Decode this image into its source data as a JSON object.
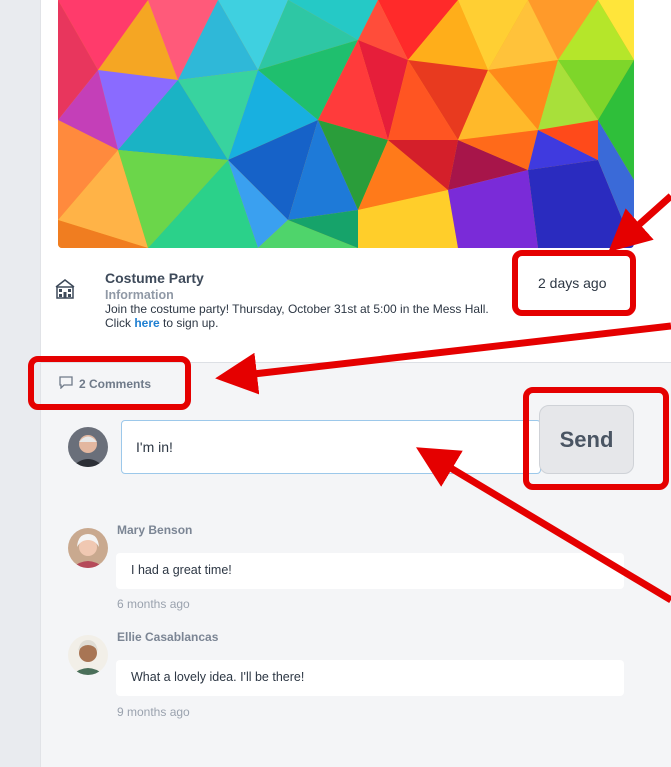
{
  "post": {
    "title": "Costume Party",
    "category": "Information",
    "body_line1": "Join the costume party! Thursday, October 31st at 5:00 in the Mess Hall.",
    "body_pre": "Click ",
    "body_link": "here",
    "body_post": " to sign up.",
    "timestamp": "2 days ago",
    "icon": "building-icon"
  },
  "comments": {
    "count_label": "2 Comments",
    "icon": "speech-bubble-icon"
  },
  "composer": {
    "value": "I'm in!",
    "send_label": "Send"
  },
  "comment_list": [
    {
      "author": "Mary Benson",
      "text": "I had a great time!",
      "time": "6 months ago"
    },
    {
      "author": "Ellie Casablancas",
      "text": "What a lovely idea. I'll be there!",
      "time": "9 months ago"
    }
  ],
  "colors": {
    "annotation": "#e50000",
    "link": "#1f7fd1"
  }
}
